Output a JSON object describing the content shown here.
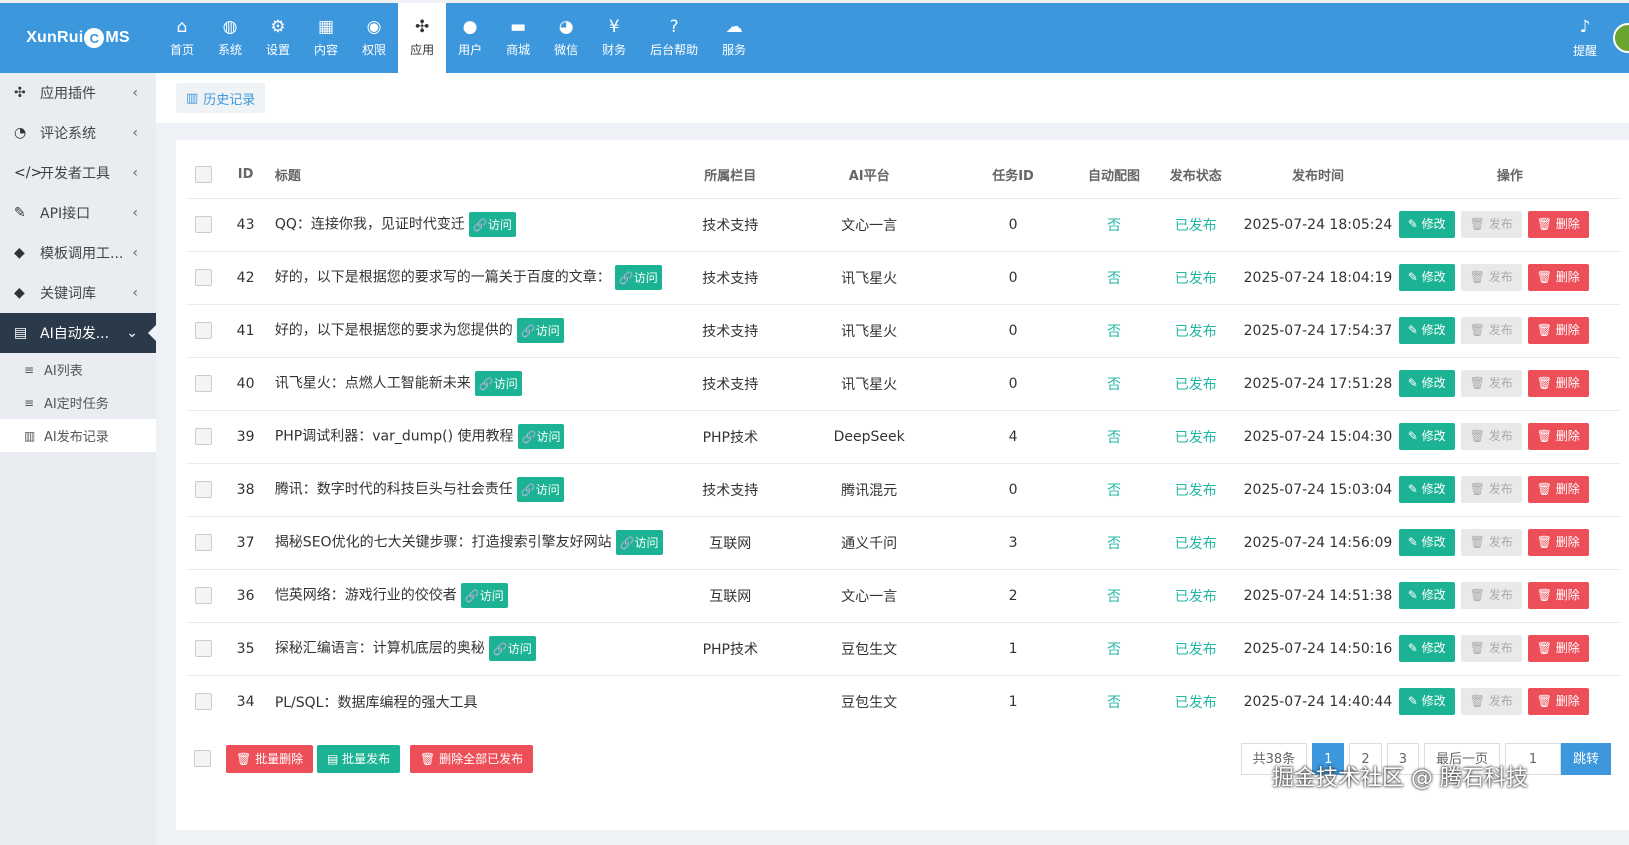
{
  "app": {
    "logo_text_left": "XunRui",
    "logo_badge": "C",
    "logo_text_right": "MS"
  },
  "topnav": [
    {
      "label": "首页",
      "icon": "home-icon",
      "glyph": "⌂"
    },
    {
      "label": "系统",
      "icon": "globe-icon",
      "glyph": "◍"
    },
    {
      "label": "设置",
      "icon": "gears-icon",
      "glyph": "⚙"
    },
    {
      "label": "内容",
      "icon": "grid-icon",
      "glyph": "▦"
    },
    {
      "label": "权限",
      "icon": "user-circle-icon",
      "glyph": "◉"
    },
    {
      "label": "应用",
      "icon": "puzzle-icon",
      "glyph": "✣",
      "active": true
    },
    {
      "label": "用户",
      "icon": "user-icon",
      "glyph": "●"
    },
    {
      "label": "商城",
      "icon": "cart-icon",
      "glyph": "▬"
    },
    {
      "label": "微信",
      "icon": "wechat-icon",
      "glyph": "◕"
    },
    {
      "label": "财务",
      "icon": "yen-icon",
      "glyph": "¥"
    },
    {
      "label": "后台帮助",
      "icon": "help-icon",
      "glyph": "?"
    },
    {
      "label": "服务",
      "icon": "cloud-icon",
      "glyph": "☁"
    }
  ],
  "top_right": {
    "label": "提醒",
    "glyph": "♪"
  },
  "sidebar": {
    "items": [
      {
        "label": "应用插件",
        "glyph": "✣",
        "icon": "puzzle-icon"
      },
      {
        "label": "评论系统",
        "glyph": "◔",
        "icon": "comments-icon"
      },
      {
        "label": "开发者工具",
        "glyph": "</>",
        "icon": "code-icon"
      },
      {
        "label": "API接口",
        "glyph": "✎",
        "icon": "plug-icon"
      },
      {
        "label": "模板调用工...",
        "glyph": "◆",
        "icon": "tag-icon"
      },
      {
        "label": "关键词库",
        "glyph": "◆",
        "icon": "tags-icon"
      },
      {
        "label": "AI自动发...",
        "glyph": "▤",
        "icon": "list-icon",
        "active": true
      }
    ],
    "subitems": [
      {
        "label": "AI列表",
        "glyph": "≡"
      },
      {
        "label": "AI定时任务",
        "glyph": "≡"
      },
      {
        "label": "AI发布记录",
        "glyph": "▥",
        "active": true
      }
    ]
  },
  "tab": {
    "label": "历史记录",
    "glyph": "▥"
  },
  "table": {
    "headers": {
      "id": "ID",
      "title": "标题",
      "cat": "所属栏目",
      "ai": "AI平台",
      "task": "任务ID",
      "auto": "自动配图",
      "status": "发布状态",
      "time": "发布时间",
      "ops": "操作"
    },
    "visit_label": "访问",
    "edit_label": "修改",
    "publish_label": "发布",
    "delete_label": "删除",
    "rows": [
      {
        "id": "43",
        "title": "QQ：连接你我，见证时代变迁",
        "visit": true,
        "cat": "技术支持",
        "ai": "文心一言",
        "task": "0",
        "auto": "否",
        "status": "已发布",
        "time": "2025-07-24 18:05:24"
      },
      {
        "id": "42",
        "title": "好的，以下是根据您的要求写的一篇关于百度的文章：",
        "visit": true,
        "cat": "技术支持",
        "ai": "讯飞星火",
        "task": "0",
        "auto": "否",
        "status": "已发布",
        "time": "2025-07-24 18:04:19"
      },
      {
        "id": "41",
        "title": "好的，以下是根据您的要求为您提供的",
        "visit": true,
        "cat": "技术支持",
        "ai": "讯飞星火",
        "task": "0",
        "auto": "否",
        "status": "已发布",
        "time": "2025-07-24 17:54:37"
      },
      {
        "id": "40",
        "title": "讯飞星火：点燃人工智能新未来",
        "visit": true,
        "cat": "技术支持",
        "ai": "讯飞星火",
        "task": "0",
        "auto": "否",
        "status": "已发布",
        "time": "2025-07-24 17:51:28"
      },
      {
        "id": "39",
        "title": "PHP调试利器：var_dump() 使用教程",
        "visit": true,
        "cat": "PHP技术",
        "ai": "DeepSeek",
        "task": "4",
        "auto": "否",
        "status": "已发布",
        "time": "2025-07-24 15:04:30"
      },
      {
        "id": "38",
        "title": "腾讯：数字时代的科技巨头与社会责任",
        "visit": true,
        "cat": "技术支持",
        "ai": "腾讯混元",
        "task": "0",
        "auto": "否",
        "status": "已发布",
        "time": "2025-07-24 15:03:04"
      },
      {
        "id": "37",
        "title": "揭秘SEO优化的七大关键步骤：打造搜索引擎友好网站",
        "visit": true,
        "cat": "互联网",
        "ai": "通义千问",
        "task": "3",
        "auto": "否",
        "status": "已发布",
        "time": "2025-07-24 14:56:09"
      },
      {
        "id": "36",
        "title": "恺英网络：游戏行业的佼佼者",
        "visit": true,
        "cat": "互联网",
        "ai": "文心一言",
        "task": "2",
        "auto": "否",
        "status": "已发布",
        "time": "2025-07-24 14:51:38"
      },
      {
        "id": "35",
        "title": "探秘汇编语言：计算机底层的奥秘",
        "visit": true,
        "cat": "PHP技术",
        "ai": "豆包生文",
        "task": "1",
        "auto": "否",
        "status": "已发布",
        "time": "2025-07-24 14:50:16"
      },
      {
        "id": "34",
        "title": "PL/SQL：数据库编程的强大工具",
        "visit": false,
        "cat": "",
        "ai": "豆包生文",
        "task": "1",
        "auto": "否",
        "status": "已发布",
        "time": "2025-07-24 14:40:44"
      }
    ]
  },
  "footer": {
    "batch_delete": "批量删除",
    "batch_publish": "批量发布",
    "delete_all_published": "删除全部已发布",
    "total": "共38条",
    "pages": [
      "1",
      "2",
      "3"
    ],
    "last_page": "最后一页",
    "jump_value": "1",
    "jump_label": "跳转"
  },
  "watermark": "掘金技术社区 @ 腾石科技",
  "colors": {
    "brand": "#3c97dd",
    "teal": "#1bb394",
    "danger": "#ed4f59",
    "sidebar_active": "#2b3a4a"
  }
}
